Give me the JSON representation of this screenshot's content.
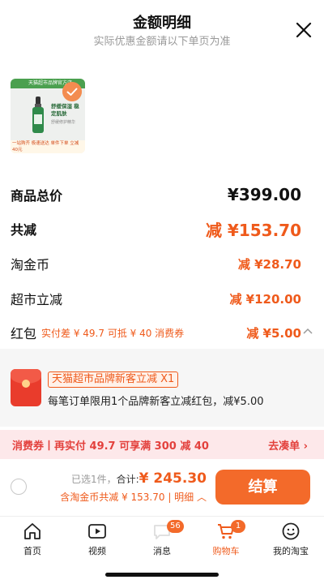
{
  "header": {
    "title": "金额明细",
    "subtitle": "实际优惠金额请以下单页为准"
  },
  "product": {
    "thumb_banner": "天猫超市品牌官方店",
    "thumb_headline": "舒缓保湿 稳定肌肤",
    "thumb_caption": "舒缓修护精华",
    "thumb_footer": "一站购齐 极速送达 单件下单 立减40元",
    "selected": true
  },
  "summary": {
    "total_label": "商品总价",
    "total_value": "¥399.00",
    "discount_label": "共减",
    "discount_value": "减 ¥153.70",
    "items": [
      {
        "label": "淘金币",
        "value": "减 ¥28.70"
      },
      {
        "label": "超市立减",
        "value": "减 ¥120.00"
      }
    ],
    "hongbao": {
      "label": "红包",
      "hint": "实付差 ¥ 49.7 可抵 ¥ 40 消费券",
      "value": "减 ¥5.00"
    }
  },
  "promo": {
    "tag": "天猫超市品牌新客立减 X1",
    "desc": "每笔订单限用1个品牌新客立减红包，减¥5.00"
  },
  "coupon_bar": {
    "text": "消费券丨再实付 49.7 可享满 300 减 40",
    "action": "去凑单 ›"
  },
  "checkout": {
    "selected_count": "已选1件，",
    "total_prefix": "合计:",
    "total_amount": "¥ 245.30",
    "detail": "含淘金币共减 ¥ 153.70 | 明细 ︿",
    "settle_label": "结算"
  },
  "tabs": [
    {
      "label": "首页",
      "icon": "home-icon"
    },
    {
      "label": "视频",
      "icon": "video-icon"
    },
    {
      "label": "消息",
      "icon": "message-icon",
      "badge": "56"
    },
    {
      "label": "购物车",
      "icon": "cart-icon",
      "badge": "1",
      "active": true
    },
    {
      "label": "我的淘宝",
      "icon": "profile-icon"
    }
  ],
  "colors": {
    "accent": "#ef5a1b",
    "settle_button": "#f36a2a",
    "coupon_bg": "#fde8ea",
    "coupon_text": "#e3413d"
  }
}
